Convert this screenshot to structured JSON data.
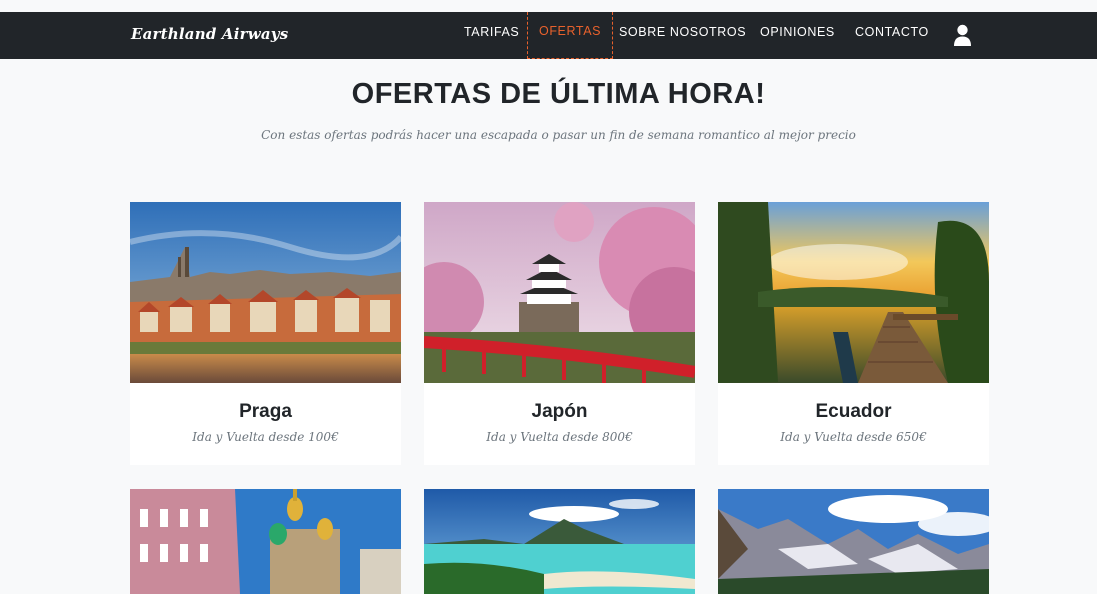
{
  "nav": {
    "brand": "Earthland Airways",
    "items": [
      {
        "label": "TARIFAS",
        "active": false
      },
      {
        "label": "OFERTAS",
        "active": true
      },
      {
        "label": "SOBRE NOSOTROS",
        "active": false
      },
      {
        "label": "OPINIONES",
        "active": false
      },
      {
        "label": "CONTACTO",
        "active": false
      }
    ],
    "user_icon": "user-icon",
    "accent_color": "#e8612c",
    "background_color": "#212529"
  },
  "header": {
    "title": "OFERTAS DE ÚLTIMA HORA!",
    "subtitle": "Con estas ofertas podrás hacer una escapada o pasar un fin de semana romantico al mejor precio"
  },
  "offers": [
    {
      "name": "Praga",
      "price": "Ida y Vuelta desde 100€"
    },
    {
      "name": "Japón",
      "price": "Ida y Vuelta desde 800€"
    },
    {
      "name": "Ecuador",
      "price": "Ida y Vuelta desde 650€"
    },
    {
      "name": "",
      "price": ""
    },
    {
      "name": "",
      "price": ""
    },
    {
      "name": "",
      "price": ""
    }
  ]
}
